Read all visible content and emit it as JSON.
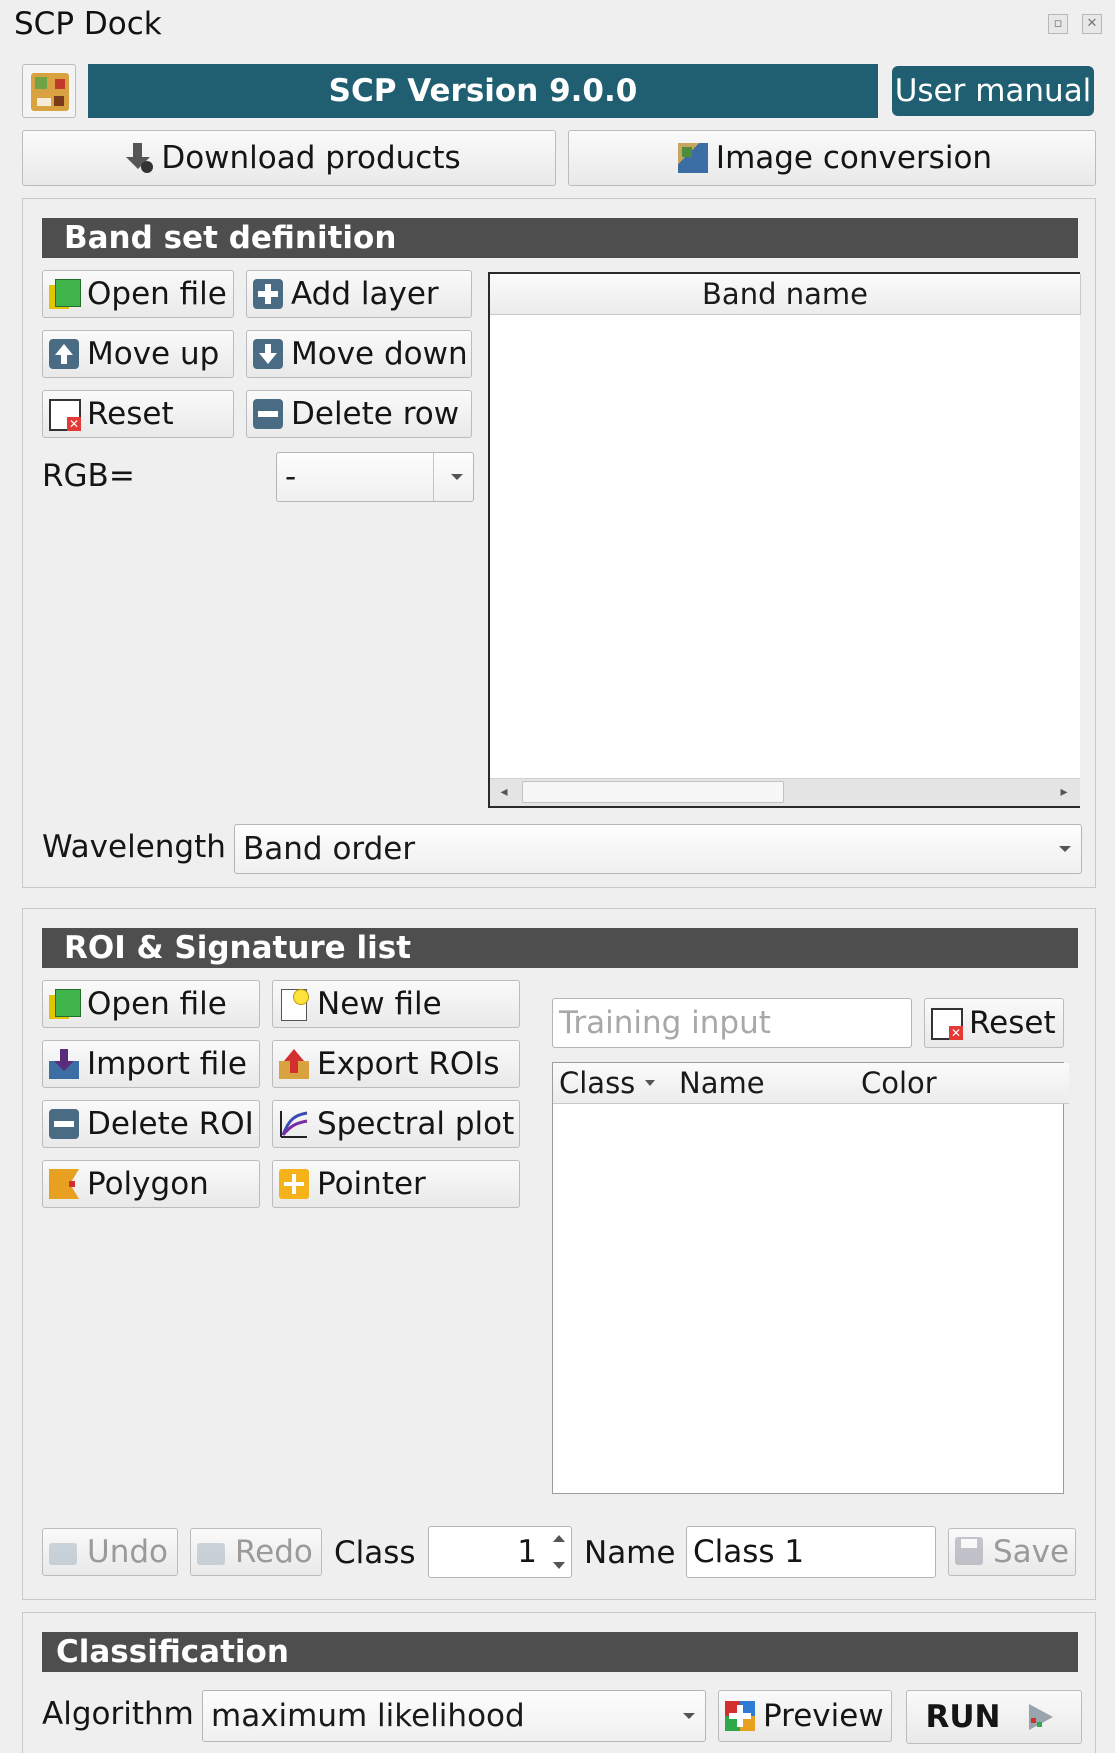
{
  "dock": {
    "title": "SCP Dock"
  },
  "header": {
    "version": "SCP Version 9.0.0",
    "manual": "User manual"
  },
  "toolbar": {
    "download": "Download products",
    "conversion": "Image conversion"
  },
  "bandset": {
    "title": "Band set definition",
    "open_file": "Open file",
    "add_layer": "Add layer",
    "move_up": "Move up",
    "move_down": "Move down",
    "reset": "Reset",
    "delete_row": "Delete row",
    "rgb_label": "RGB=",
    "rgb_value": "-",
    "table_header": "Band name",
    "wavelength_label": "Wavelength",
    "wavelength_value": "Band order"
  },
  "roi": {
    "title": "ROI & Signature list",
    "open_file": "Open file",
    "new_file": "New file",
    "import_file": "Import file",
    "export_rois": "Export ROIs",
    "delete_roi": "Delete ROI",
    "spectral_plot": "Spectral plot",
    "polygon": "Polygon",
    "pointer": "Pointer",
    "training_placeholder": "Training input",
    "reset": "Reset",
    "columns": [
      "Class",
      "Name",
      "Color"
    ],
    "undo": "Undo",
    "redo": "Redo",
    "class_label": "Class",
    "class_value": "1",
    "name_label": "Name",
    "name_value": "Class 1",
    "save": "Save"
  },
  "classification": {
    "title": "Classification",
    "algorithm_label": "Algorithm",
    "algorithm_value": "maximum likelihood",
    "preview": "Preview",
    "run": "RUN"
  },
  "colors": {
    "header_bar": "#1f5f71",
    "section_head": "#4e4e4e",
    "panel_bg": "#efefef"
  }
}
